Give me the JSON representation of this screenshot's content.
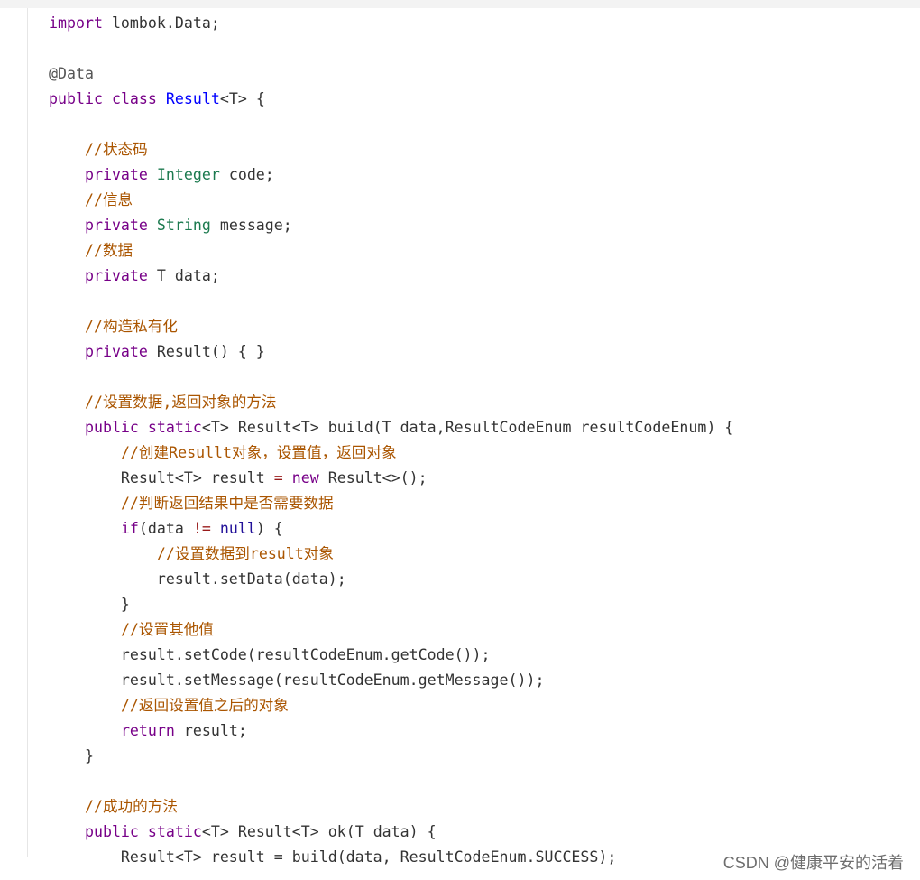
{
  "palette": {
    "keyword": "#770088",
    "class_name": "#0000ff",
    "builtin_type": "#1c7a4f",
    "comment": "#aa5500",
    "annotation": "#555555",
    "null_literal": "#221199",
    "text": "#333333",
    "operator": "#981a1a"
  },
  "code_lines": [
    [
      [
        "kw",
        "import"
      ],
      [
        "txt",
        " lombok.Data;"
      ]
    ],
    [],
    [
      [
        "ann",
        "@Data"
      ]
    ],
    [
      [
        "kw",
        "public"
      ],
      [
        "txt",
        " "
      ],
      [
        "kw",
        "class"
      ],
      [
        "txt",
        " "
      ],
      [
        "type",
        "Result"
      ],
      [
        "txt",
        "<T> {"
      ]
    ],
    [],
    [
      [
        "txt",
        "    "
      ],
      [
        "cm",
        "//状态码"
      ]
    ],
    [
      [
        "txt",
        "    "
      ],
      [
        "kw",
        "private"
      ],
      [
        "txt",
        " "
      ],
      [
        "tp",
        "Integer"
      ],
      [
        "txt",
        " code;"
      ]
    ],
    [
      [
        "txt",
        "    "
      ],
      [
        "cm",
        "//信息"
      ]
    ],
    [
      [
        "txt",
        "    "
      ],
      [
        "kw",
        "private"
      ],
      [
        "txt",
        " "
      ],
      [
        "tp",
        "String"
      ],
      [
        "txt",
        " message;"
      ]
    ],
    [
      [
        "txt",
        "    "
      ],
      [
        "cm",
        "//数据"
      ]
    ],
    [
      [
        "txt",
        "    "
      ],
      [
        "kw",
        "private"
      ],
      [
        "txt",
        " T data;"
      ]
    ],
    [],
    [
      [
        "txt",
        "    "
      ],
      [
        "cm",
        "//构造私有化"
      ]
    ],
    [
      [
        "txt",
        "    "
      ],
      [
        "kw",
        "private"
      ],
      [
        "txt",
        " Result() { }"
      ]
    ],
    [],
    [
      [
        "txt",
        "    "
      ],
      [
        "cm",
        "//设置数据,返回对象的方法"
      ]
    ],
    [
      [
        "txt",
        "    "
      ],
      [
        "kw",
        "public"
      ],
      [
        "txt",
        " "
      ],
      [
        "kw",
        "static"
      ],
      [
        "txt",
        "<T> Result<T> build(T data,ResultCodeEnum resultCodeEnum) {"
      ]
    ],
    [
      [
        "txt",
        "        "
      ],
      [
        "cm",
        "//创建Resullt对象，设置值，返回对象"
      ]
    ],
    [
      [
        "txt",
        "        Result<T> result "
      ],
      [
        "op",
        "="
      ],
      [
        "txt",
        " "
      ],
      [
        "kw",
        "new"
      ],
      [
        "txt",
        " Result<>();"
      ]
    ],
    [
      [
        "txt",
        "        "
      ],
      [
        "cm",
        "//判断返回结果中是否需要数据"
      ]
    ],
    [
      [
        "txt",
        "        "
      ],
      [
        "kw",
        "if"
      ],
      [
        "txt",
        "(data "
      ],
      [
        "op",
        "!="
      ],
      [
        "txt",
        " "
      ],
      [
        "nil",
        "null"
      ],
      [
        "txt",
        ") {"
      ]
    ],
    [
      [
        "txt",
        "            "
      ],
      [
        "cm",
        "//设置数据到result对象"
      ]
    ],
    [
      [
        "txt",
        "            result.setData(data);"
      ]
    ],
    [
      [
        "txt",
        "        }"
      ]
    ],
    [
      [
        "txt",
        "        "
      ],
      [
        "cm",
        "//设置其他值"
      ]
    ],
    [
      [
        "txt",
        "        result.setCode(resultCodeEnum.getCode());"
      ]
    ],
    [
      [
        "txt",
        "        result.setMessage(resultCodeEnum.getMessage());"
      ]
    ],
    [
      [
        "txt",
        "        "
      ],
      [
        "cm",
        "//返回设置值之后的对象"
      ]
    ],
    [
      [
        "txt",
        "        "
      ],
      [
        "kw",
        "return"
      ],
      [
        "txt",
        " result;"
      ]
    ],
    [
      [
        "txt",
        "    }"
      ]
    ],
    [],
    [
      [
        "txt",
        "    "
      ],
      [
        "cm",
        "//成功的方法"
      ]
    ],
    [
      [
        "txt",
        "    "
      ],
      [
        "kw",
        "public"
      ],
      [
        "txt",
        " "
      ],
      [
        "kw",
        "static"
      ],
      [
        "txt",
        "<T> Result<T> ok(T data) {"
      ]
    ],
    [
      [
        "txt",
        "        Result<T> result = build(data, ResultCodeEnum.SUCCESS);"
      ]
    ]
  ],
  "watermark": "CSDN @健康平安的活着"
}
